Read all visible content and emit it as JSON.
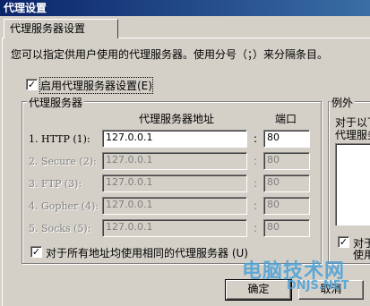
{
  "window": {
    "title": "代理设置"
  },
  "tabs": [
    {
      "label": "代理服务器设置"
    }
  ],
  "instruction": "您可以指定供用户使用的代理服务器。使用分号（；）来分隔条目。",
  "enable_proxy": {
    "label": "启用代理服务器设置(E)",
    "checked": true,
    "check_glyph": "✓"
  },
  "proxy_group": {
    "title": "代理服务器",
    "address_header": "代理服务器地址",
    "port_header": "端口",
    "colon": ":",
    "rows": [
      {
        "label": "1.  HTTP (1):",
        "address": "127.0.0.1",
        "port": "80",
        "enabled": true
      },
      {
        "label": "2.  Secure (2):",
        "address": "127.0.0.1",
        "port": "80",
        "enabled": false
      },
      {
        "label": "3.  FTP (3):",
        "address": "127.0.0.1",
        "port": "80",
        "enabled": false
      },
      {
        "label": "4.  Gopher (4):",
        "address": "127.0.0.1",
        "port": "80",
        "enabled": false
      },
      {
        "label": "5.  Socks (5):",
        "address": "127.0.0.1",
        "port": "80",
        "enabled": false
      }
    ],
    "same_proxy": {
      "label": "对于所有地址均使用相同的代理服务器 (U)",
      "checked": true
    }
  },
  "exceptions_group": {
    "title": "例外",
    "desc_line1": "对于以下",
    "desc_line2": "代理服务",
    "bypass": {
      "label_line1": "对于",
      "label_line2": "使用",
      "checked": true
    }
  },
  "buttons": {
    "ok": "确定",
    "cancel": "取消"
  },
  "watermark": {
    "text": "电脑技术网",
    "sub": "DNJS.NET"
  }
}
